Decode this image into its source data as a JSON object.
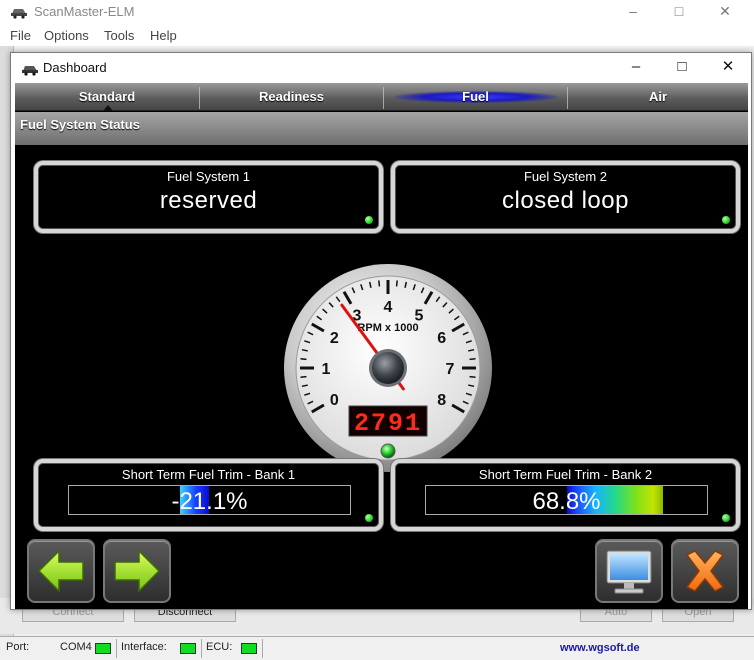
{
  "main_window": {
    "title": "ScanMaster-ELM",
    "menu": [
      "File",
      "Options",
      "Tools",
      "Help"
    ],
    "buttons": [
      "Connect",
      "Disconnect",
      "Auto",
      "Open"
    ]
  },
  "statusbar": {
    "port_label": "Port:",
    "port_value": "COM4",
    "interface_label": "Interface:",
    "ecu_label": "ECU:",
    "website": "www.wgsoft.de"
  },
  "dashboard": {
    "title": "Dashboard",
    "tabs": [
      "Standard",
      "Readiness",
      "Fuel",
      "Air"
    ],
    "active_tab": "Fuel",
    "section_title": "Fuel System Status",
    "fuel_system_1": {
      "label": "Fuel System 1",
      "value": "reserved"
    },
    "fuel_system_2": {
      "label": "Fuel System 2",
      "value": "closed loop"
    },
    "trim_bank_1": {
      "label": "Short Term Fuel Trim - Bank 1",
      "value": "-21.1%",
      "percent": -21.1
    },
    "trim_bank_2": {
      "label": "Short Term Fuel Trim - Bank 2",
      "value": "68.8%",
      "percent": 68.8
    },
    "gauge": {
      "unit_label": "RPM x 1000",
      "ticks": [
        "0",
        "1",
        "2",
        "3",
        "4",
        "5",
        "6",
        "7",
        "8"
      ],
      "min": 0,
      "max": 8,
      "rpm_readout": "2791",
      "rpm_value": 2791
    }
  },
  "colors": {
    "led_on": "#1fcf2a",
    "needle": "#e01010",
    "digital_readout": "#ff2a1a",
    "arrow_green": "#9be21e",
    "close_orange": "#ff7a1a",
    "website_blue": "#1a1aa6"
  },
  "icons": {
    "back": "arrow-left-icon",
    "forward": "arrow-right-icon",
    "monitor": "monitor-icon",
    "close": "close-x-icon"
  }
}
